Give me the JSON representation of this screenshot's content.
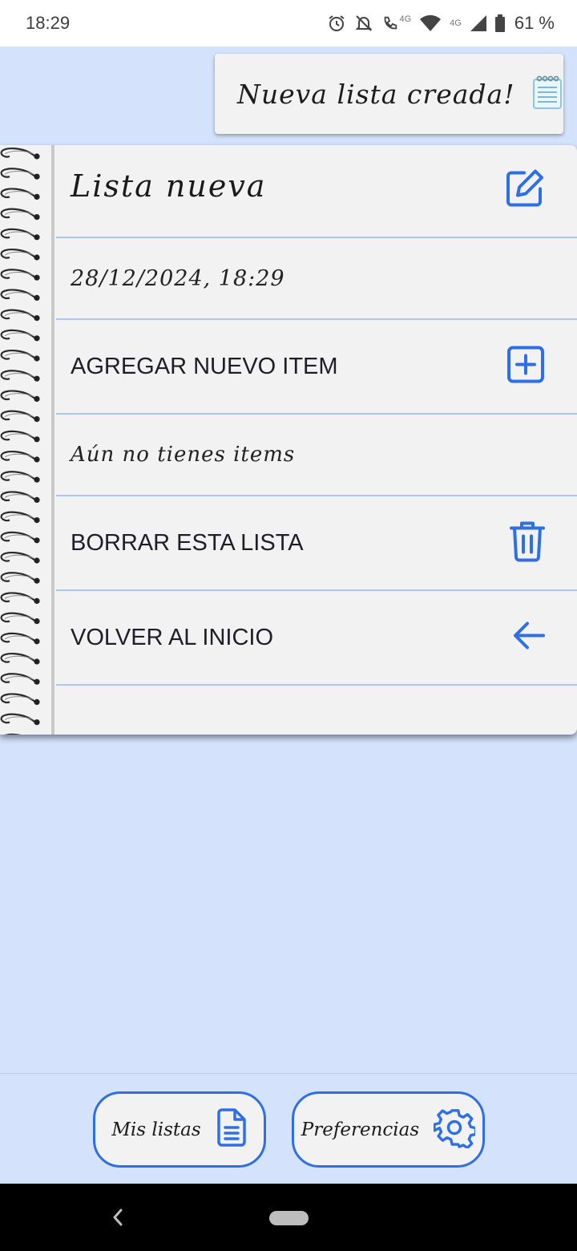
{
  "status_bar": {
    "time": "18:29",
    "net1": "4G",
    "net2": "4G",
    "battery": "61 %"
  },
  "toast": {
    "text": "Nueva lista creada!",
    "icon": "notepad-icon"
  },
  "list": {
    "title": "Lista nueva",
    "date": "28/12/2024, 18:29",
    "add_item_label": "AGREGAR NUEVO ITEM",
    "empty_message": "Aún no tienes items",
    "delete_label": "BORRAR ESTA LISTA",
    "back_label": "VOLVER AL INICIO"
  },
  "bottom_nav": {
    "lists_label": "Mis listas",
    "prefs_label": "Preferencias"
  },
  "colors": {
    "accent": "#2f6fe6",
    "background": "#d4e2fc",
    "card": "#f2f2f2",
    "divider": "#a9c8f3"
  }
}
